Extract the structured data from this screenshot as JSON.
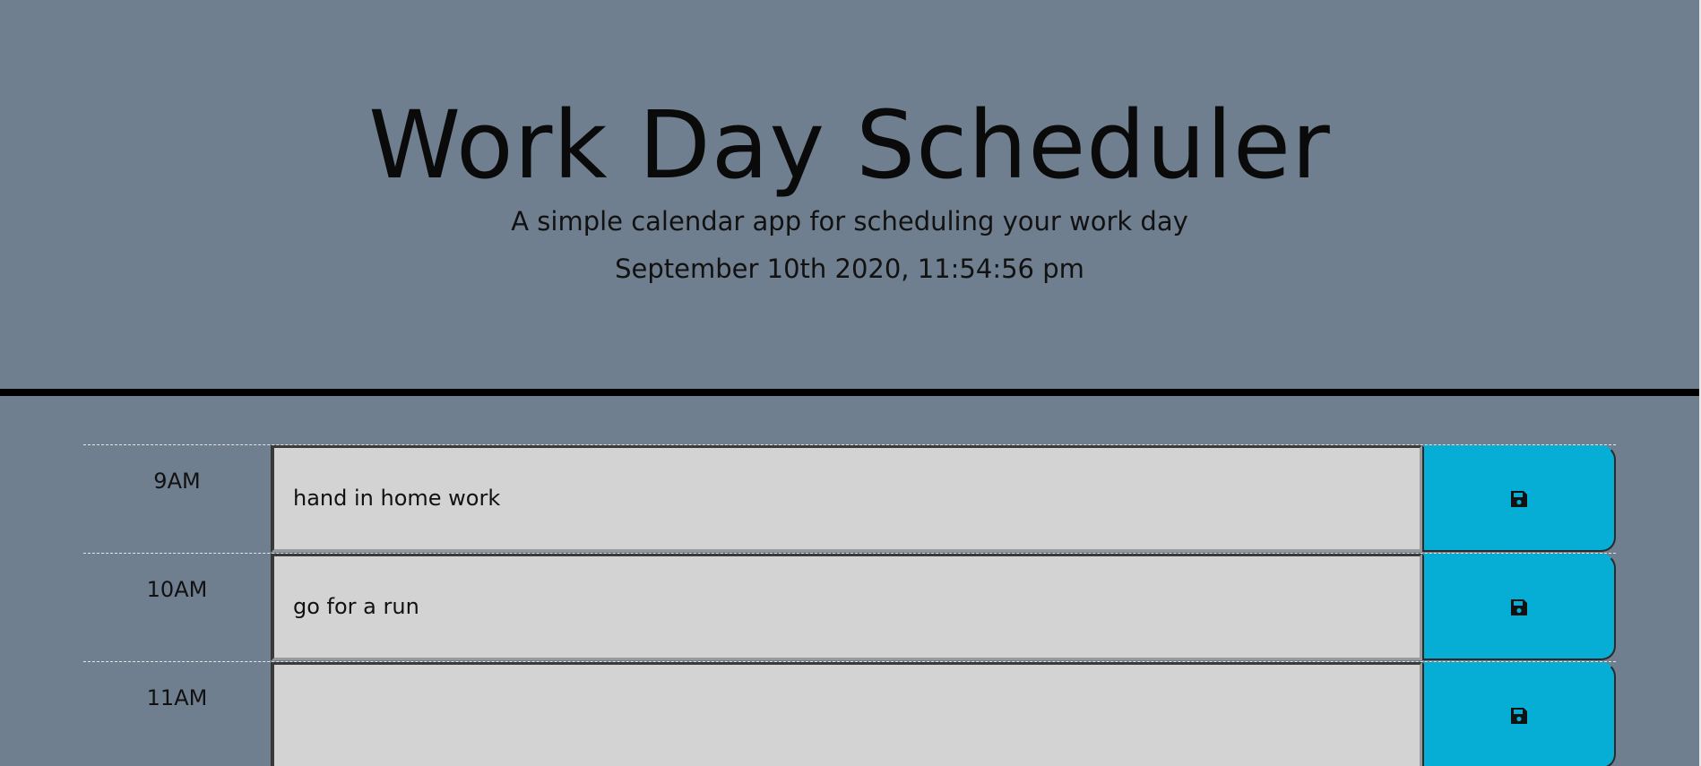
{
  "header": {
    "title": "Work Day Scheduler",
    "subtitle": "A simple calendar app for scheduling your work day",
    "current_datetime": "September 10th 2020, 11:54:56 pm"
  },
  "time_blocks": [
    {
      "hour": "9AM",
      "description": "hand in home work",
      "save_icon": "save-icon"
    },
    {
      "hour": "10AM",
      "description": "go for a run",
      "save_icon": "save-icon"
    },
    {
      "hour": "11AM",
      "description": "",
      "save_icon": "save-icon"
    }
  ],
  "colors": {
    "background": "#6f7f8f",
    "textarea": "#d3d3d3",
    "save_button": "#06aed5",
    "divider": "#000000"
  }
}
